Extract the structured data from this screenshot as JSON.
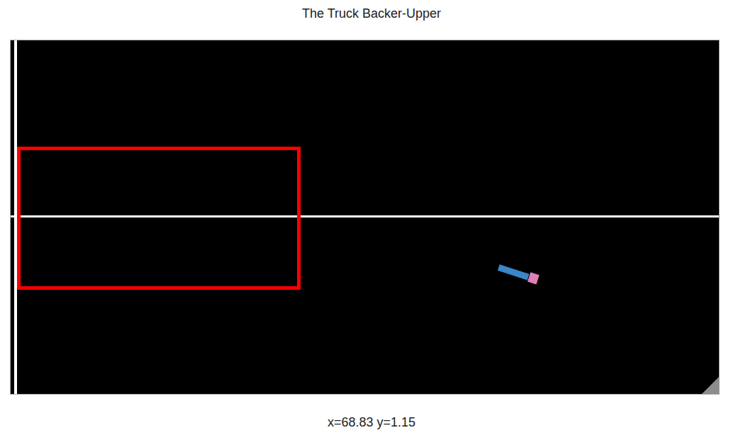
{
  "window": {
    "title": "The Truck Backer-Upper"
  },
  "status": "x=68.83 y=1.15"
}
